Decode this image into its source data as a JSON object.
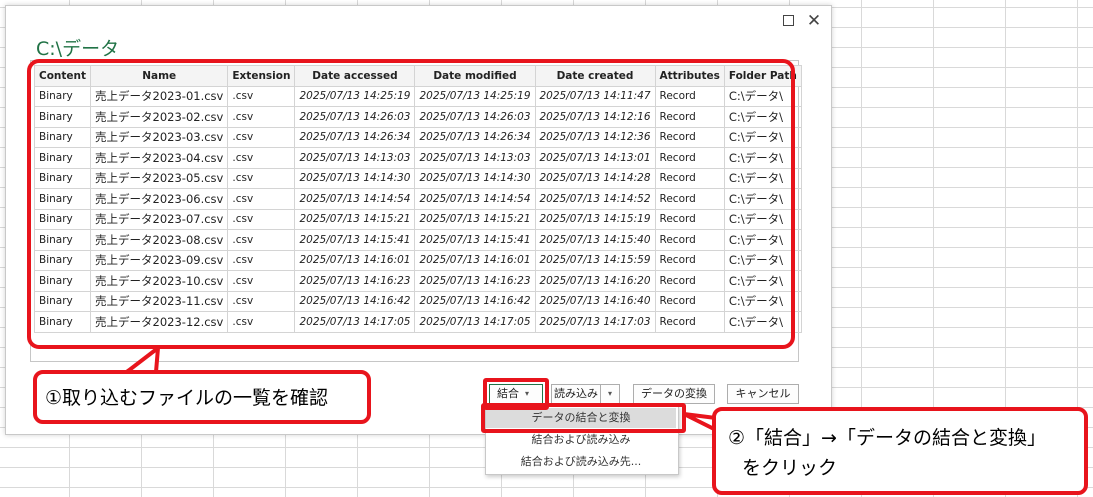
{
  "dialog": {
    "title": "C:\\データ",
    "maximize_icon": "maximize-icon",
    "close_icon": "close-icon",
    "close_glyph": "✕"
  },
  "table": {
    "columns": [
      "Content",
      "Name",
      "Extension",
      "Date accessed",
      "Date modified",
      "Date created",
      "Attributes",
      "Folder Path"
    ],
    "rows": [
      [
        "Binary",
        "売上データ2023-01.csv",
        ".csv",
        "2025/07/13 14:25:19",
        "2025/07/13 14:25:19",
        "2025/07/13 14:11:47",
        "Record",
        "C:\\データ\\"
      ],
      [
        "Binary",
        "売上データ2023-02.csv",
        ".csv",
        "2025/07/13 14:26:03",
        "2025/07/13 14:26:03",
        "2025/07/13 14:12:16",
        "Record",
        "C:\\データ\\"
      ],
      [
        "Binary",
        "売上データ2023-03.csv",
        ".csv",
        "2025/07/13 14:26:34",
        "2025/07/13 14:26:34",
        "2025/07/13 14:12:36",
        "Record",
        "C:\\データ\\"
      ],
      [
        "Binary",
        "売上データ2023-04.csv",
        ".csv",
        "2025/07/13 14:13:03",
        "2025/07/13 14:13:03",
        "2025/07/13 14:13:01",
        "Record",
        "C:\\データ\\"
      ],
      [
        "Binary",
        "売上データ2023-05.csv",
        ".csv",
        "2025/07/13 14:14:30",
        "2025/07/13 14:14:30",
        "2025/07/13 14:14:28",
        "Record",
        "C:\\データ\\"
      ],
      [
        "Binary",
        "売上データ2023-06.csv",
        ".csv",
        "2025/07/13 14:14:54",
        "2025/07/13 14:14:54",
        "2025/07/13 14:14:52",
        "Record",
        "C:\\データ\\"
      ],
      [
        "Binary",
        "売上データ2023-07.csv",
        ".csv",
        "2025/07/13 14:15:21",
        "2025/07/13 14:15:21",
        "2025/07/13 14:15:19",
        "Record",
        "C:\\データ\\"
      ],
      [
        "Binary",
        "売上データ2023-08.csv",
        ".csv",
        "2025/07/13 14:15:41",
        "2025/07/13 14:15:41",
        "2025/07/13 14:15:40",
        "Record",
        "C:\\データ\\"
      ],
      [
        "Binary",
        "売上データ2023-09.csv",
        ".csv",
        "2025/07/13 14:16:01",
        "2025/07/13 14:16:01",
        "2025/07/13 14:15:59",
        "Record",
        "C:\\データ\\"
      ],
      [
        "Binary",
        "売上データ2023-10.csv",
        ".csv",
        "2025/07/13 14:16:23",
        "2025/07/13 14:16:23",
        "2025/07/13 14:16:20",
        "Record",
        "C:\\データ\\"
      ],
      [
        "Binary",
        "売上データ2023-11.csv",
        ".csv",
        "2025/07/13 14:16:42",
        "2025/07/13 14:16:42",
        "2025/07/13 14:16:40",
        "Record",
        "C:\\データ\\"
      ],
      [
        "Binary",
        "売上データ2023-12.csv",
        ".csv",
        "2025/07/13 14:17:05",
        "2025/07/13 14:17:05",
        "2025/07/13 14:17:03",
        "Record",
        "C:\\データ\\"
      ]
    ]
  },
  "buttons": {
    "combine": "結合",
    "combine_arrow": "▾",
    "load": "読み込み",
    "load_arrow": "▾",
    "transform": "データの変換",
    "cancel": "キャンセル"
  },
  "combine_menu": {
    "items": [
      "データの結合と変換",
      "結合および読み込み",
      "結合および読み込み先..."
    ]
  },
  "annotations": {
    "callout1": "①取り込むファイルの一覧を確認",
    "callout2_line1": "②「結合」→「データの結合と変換」",
    "callout2_line2": "をクリック"
  },
  "colors": {
    "highlight_red": "#e8141c",
    "title_green": "#217346"
  }
}
